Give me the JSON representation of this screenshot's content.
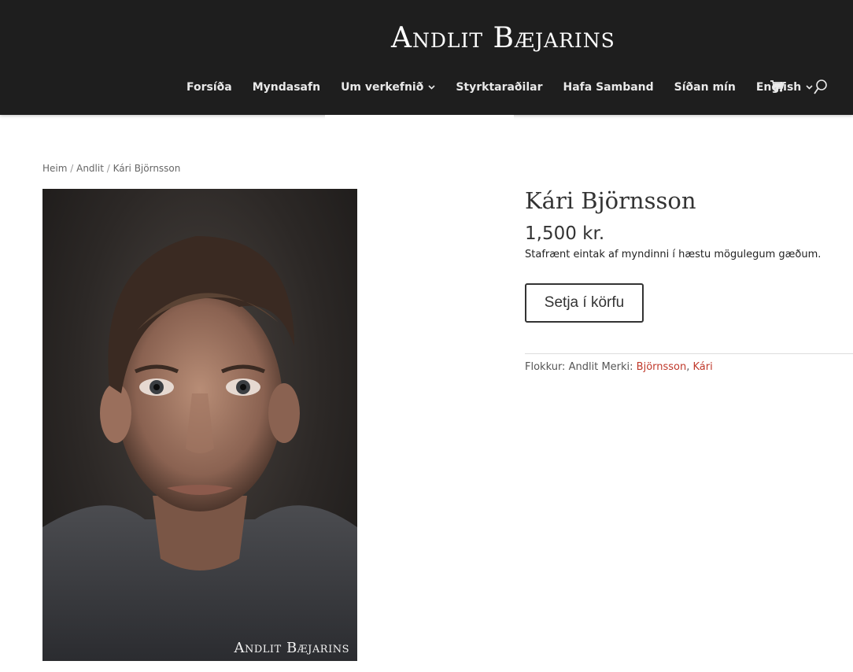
{
  "site": {
    "logo": "Andlit Bæjarins"
  },
  "nav": {
    "items": [
      {
        "label": "Forsíða",
        "has_dropdown": false
      },
      {
        "label": "Myndasafn",
        "has_dropdown": false
      },
      {
        "label": "Um verkefnið",
        "has_dropdown": true
      },
      {
        "label": "Styrktaraðilar",
        "has_dropdown": false
      },
      {
        "label": "Hafa Samband",
        "has_dropdown": false
      },
      {
        "label": "Síðan mín",
        "has_dropdown": false
      },
      {
        "label": "English",
        "has_dropdown": true
      }
    ],
    "cart_icon": "cart-icon",
    "search_icon": "search-icon",
    "dropdown_chevron": "chevron-down-icon"
  },
  "breadcrumb": {
    "items": [
      "Heim",
      "Andlit",
      "Kári Björnsson"
    ],
    "separator": " / "
  },
  "product": {
    "title": "Kári Björnsson",
    "price": "1,500 kr.",
    "description": "Stafrænt eintak af myndinni í hæstu mögulegum gæðum.",
    "add_to_cart": "Setja í körfu",
    "category_label": "Flokkur:",
    "category": "Andlit",
    "tags_label": "Merki:",
    "tags": [
      "Björnsson",
      "Kári"
    ],
    "tag_separator": ", ",
    "image_watermark": "Andlit Bæjarins"
  },
  "colors": {
    "header_bg": "#1e1e1e",
    "nav_text": "#e9e9e9",
    "tag_link": "#c0392b",
    "button_border": "#333333"
  }
}
